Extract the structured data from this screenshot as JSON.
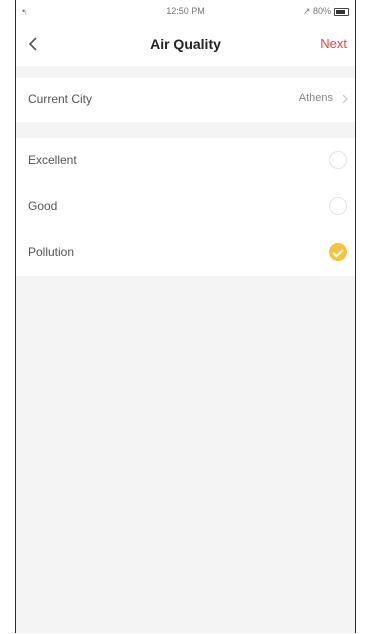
{
  "status_bar": {
    "signal": "•ᵢ",
    "time": "12:50 PM",
    "battery_text": "↗ 80%"
  },
  "nav": {
    "title": "Air Quality",
    "next_label": "Next"
  },
  "city": {
    "label": "Current City",
    "value": "Athens"
  },
  "options": [
    {
      "label": "Excellent",
      "selected": false
    },
    {
      "label": "Good",
      "selected": false
    },
    {
      "label": "Pollution",
      "selected": true
    }
  ],
  "colors": {
    "accent": "#e8473c",
    "selected": "#f5c341",
    "background": "#f4f4f5"
  }
}
